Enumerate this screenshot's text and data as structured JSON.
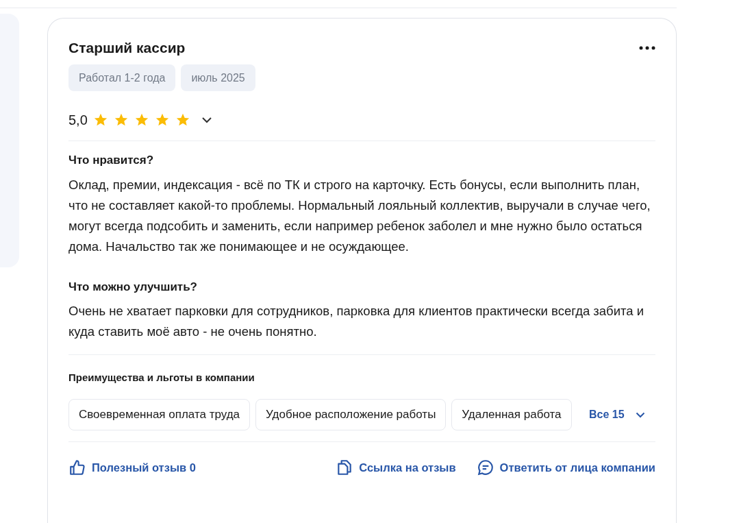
{
  "review": {
    "title": "Старший кассир",
    "tags": [
      "Работал 1-2 года",
      "июль 2025"
    ],
    "rating": {
      "value": "5,0",
      "stars": 5
    },
    "sections": [
      {
        "heading": "Что нравится?",
        "text": "Оклад, премии, индексация - всё по ТК и строго на карточку. Есть бонусы, если выполнить план, что не составляет какой-то проблемы. Нормальный лояльный коллектив, выручали в случае чего, могут всегда подсобить и заменить, если например ребенок заболел и мне нужно было остаться дома. Начальство так же понимающее и не осуждающее."
      },
      {
        "heading": "Что можно улучшить?",
        "text": "Очень не хватает парковки для сотрудников, парковка для клиентов практически всегда забита и куда ставить моё авто - не очень понятно."
      }
    ],
    "benefits": {
      "heading": "Преимущества и льготы в компании",
      "items": [
        "Своевременная оплата труда",
        "Удобное расположение работы",
        "Удаленная работа"
      ],
      "more": "Все 15"
    },
    "actions": [
      {
        "kind": "like",
        "label": "Полезный отзыв 0"
      },
      {
        "kind": "link",
        "label": "Ссылка на отзыв"
      },
      {
        "kind": "reply",
        "label": "Ответить от лица компании"
      }
    ]
  }
}
